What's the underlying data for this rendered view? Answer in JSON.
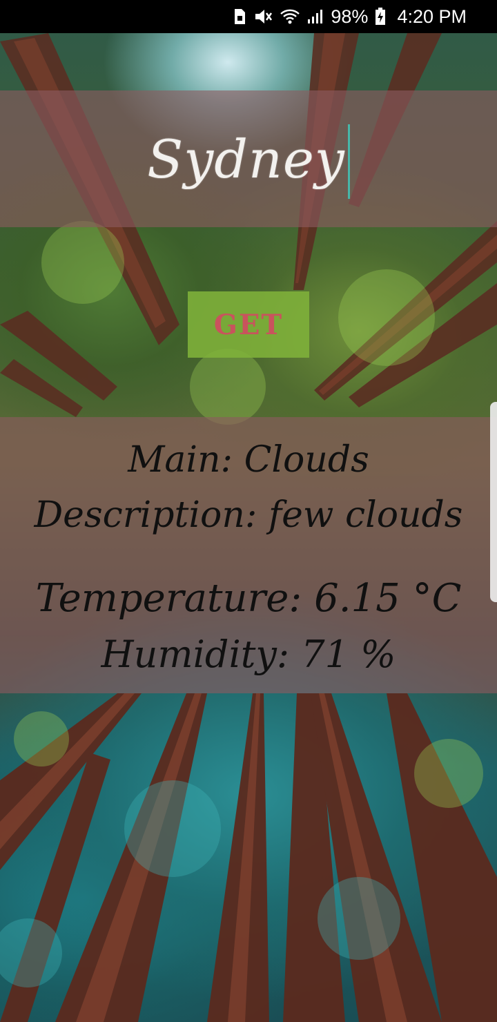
{
  "status_bar": {
    "battery_percent": "98%",
    "time": "4:20 PM",
    "icons": [
      "sim-icon",
      "mute-icon",
      "wifi-icon",
      "signal-icon",
      "battery-charging-icon"
    ]
  },
  "city_input": {
    "value": "Sydney"
  },
  "get_button": {
    "label": "GET"
  },
  "weather": {
    "main": "Main: Clouds",
    "description": "Description: few clouds",
    "temperature": "Temperature: 6.15 °C",
    "humidity": "Humidity: 71 %"
  },
  "colors": {
    "panel": "#8c5a5f",
    "button": "#80b23a",
    "button_text": "#c9535d",
    "caret": "#47b7a9"
  }
}
